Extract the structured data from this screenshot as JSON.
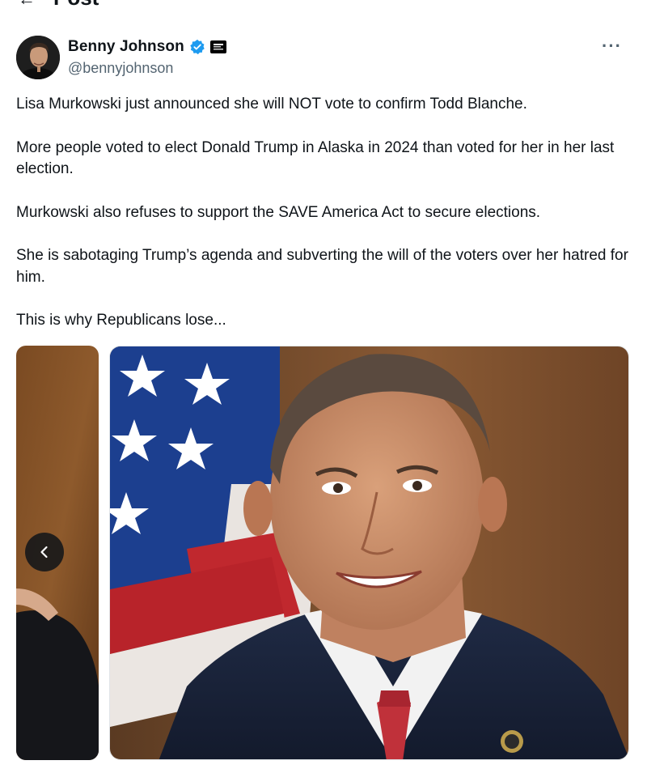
{
  "header": {
    "back_glyph": "←",
    "title": "Post"
  },
  "author": {
    "display_name": "Benny Johnson",
    "handle": "@bennyjohnson",
    "verified_icon": "verified-badge-icon",
    "affiliate_icon": "affiliate-badge-icon",
    "more_label": "···"
  },
  "tweet": {
    "paragraphs": [
      "Lisa Murkowski just announced she will NOT vote to confirm Todd Blanche.",
      "More people voted to elect Donald Trump in Alaska in 2024 than voted for her in her last election.",
      "Murkowski also refuses to support the SAVE America Act to secure elections.",
      "She is sabotaging Trump’s agenda and subverting the will of the voters over her hatred for him.",
      "This is why Republicans lose..."
    ]
  },
  "media": {
    "prev_icon": "chevron-left-icon",
    "main_photo": "portrait-photo-man-in-suit-flag-background",
    "side_photo": "partial-photo-previous-image"
  },
  "colors": {
    "accent": "#1d9bf0",
    "secondary_text": "#536471",
    "text": "#0f1419"
  }
}
